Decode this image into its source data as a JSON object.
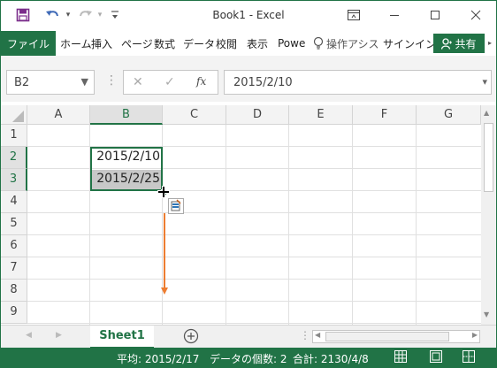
{
  "window": {
    "title": "Book1 - Excel"
  },
  "ribbon": {
    "file": "ファイル",
    "tabs": [
      "ホーム",
      "挿入",
      "ページ",
      "数式",
      "データ",
      "校閲",
      "表示",
      "Powe"
    ],
    "tell_me": "操作アシス",
    "signin": "サインイン",
    "share": "共有"
  },
  "formula_bar": {
    "name_box": "B2",
    "formula": "2015/2/10",
    "fx": "fx"
  },
  "columns": [
    "A",
    "B",
    "C",
    "D",
    "E",
    "F",
    "G"
  ],
  "rows": [
    "1",
    "2",
    "3",
    "4",
    "5",
    "6",
    "7",
    "8",
    "9"
  ],
  "cells": {
    "B2": "2015/2/10",
    "B3": "2015/2/25"
  },
  "sheets": {
    "active": "Sheet1"
  },
  "status_bar": {
    "average": "平均: 2015/2/17",
    "count": "データの個数: 2",
    "sum": "合計: 2130/4/8"
  },
  "colors": {
    "accent": "#217346",
    "drag_arrow": "#ed7d31"
  },
  "icons": [
    "save-icon",
    "undo-icon",
    "redo-icon",
    "qat-customize-icon",
    "ribbon-display-icon",
    "minimize-icon",
    "maximize-icon",
    "close-icon",
    "lightbulb-icon",
    "person-icon",
    "autofill-options-icon",
    "fill-cursor-icon",
    "add-sheet-icon"
  ]
}
